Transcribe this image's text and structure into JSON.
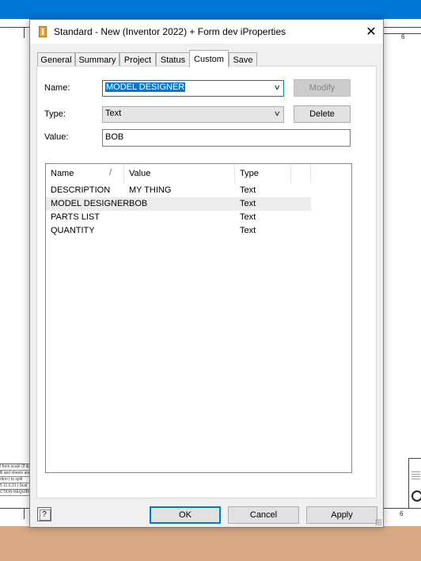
{
  "background": {
    "zone_number": "6",
    "title_block_lines": [
      "l from scale (if dpi",
      "lll and sheets are",
      "rtion | to split",
      "5 11.0.31 | Scal",
      "CTION REQUIRE"
    ]
  },
  "dialog": {
    "title": "Standard - New (Inventor 2022) + Form dev iProperties",
    "close_icon": "✕",
    "tabs": [
      {
        "label": "General",
        "active": false
      },
      {
        "label": "Summary",
        "active": false
      },
      {
        "label": "Project",
        "active": false
      },
      {
        "label": "Status",
        "active": false
      },
      {
        "label": "Custom",
        "active": true
      },
      {
        "label": "Save",
        "active": false
      }
    ],
    "name_label": "Name:",
    "name_value": "MODEL DESIGNER",
    "type_label": "Type:",
    "type_value": "Text",
    "value_label": "Value:",
    "value_value": "BOB",
    "modify_button": "Modify",
    "delete_button": "Delete",
    "list": {
      "columns": [
        "Name",
        "Value",
        "Type"
      ],
      "sort_indicator": "/",
      "rows": [
        {
          "name": "DESCRIPTION",
          "value": "MY THING",
          "type": "Text"
        },
        {
          "name": "MODEL DESIGNER",
          "value": "BOB",
          "type": "Text",
          "selected": true
        },
        {
          "name": "PARTS LIST",
          "value": "",
          "type": "Text"
        },
        {
          "name": "QUANTITY",
          "value": "",
          "type": "Text"
        }
      ]
    },
    "help_icon": "?",
    "ok_button": "OK",
    "cancel_button": "Cancel",
    "apply_button": "Apply"
  },
  "colors": {
    "accent": "#0078d7",
    "desk": "#d9a985"
  }
}
